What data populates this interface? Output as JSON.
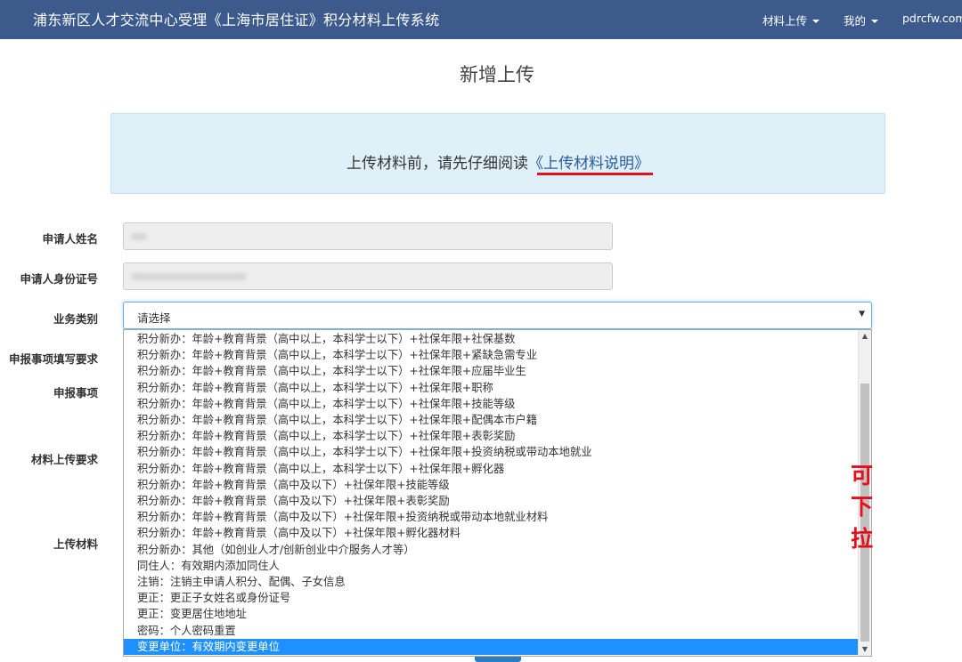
{
  "header": {
    "title": "浦东新区人才交流中心受理《上海市居住证》积分材料上传系统",
    "menu_upload": "材料上传",
    "menu_mine": "我的",
    "user": "pdrcfw.com"
  },
  "page": {
    "title": "新增上传"
  },
  "notice": {
    "prefix": "上传材料前，请先仔细阅读",
    "link": "《上传材料说明》"
  },
  "form": {
    "labels": {
      "name": "申请人姓名",
      "id_number": "申请人身份证号",
      "business_type": "业务类别",
      "fill_requirements": "申报事项填写要求",
      "declaration_item": "申报事项",
      "upload_requirements": "材料上传要求",
      "upload_material": "上传材料"
    },
    "business_type_value": "请选择"
  },
  "dropdown": {
    "options": [
      "积分新办：年龄+教育背景（高中以上，本科学士以下）+社保年限+社保基数",
      "积分新办：年龄+教育背景（高中以上，本科学士以下）+社保年限+紧缺急需专业",
      "积分新办：年龄+教育背景（高中以上，本科学士以下）+社保年限+应届毕业生",
      "积分新办：年龄+教育背景（高中以上，本科学士以下）+社保年限+职称",
      "积分新办：年龄+教育背景（高中以上，本科学士以下）+社保年限+技能等级",
      "积分新办：年龄+教育背景（高中以上，本科学士以下）+社保年限+配偶本市户籍",
      "积分新办：年龄+教育背景（高中以上，本科学士以下）+社保年限+表彰奖励",
      "积分新办：年龄+教育背景（高中以上，本科学士以下）+社保年限+投资纳税或带动本地就业",
      "积分新办：年龄+教育背景（高中以上，本科学士以下）+社保年限+孵化器",
      "积分新办：年龄+教育背景（高中及以下）+社保年限+技能等级",
      "积分新办：年龄+教育背景（高中及以下）+社保年限+表彰奖励",
      "积分新办：年龄+教育背景（高中及以下）+社保年限+投资纳税或带动本地就业材料",
      "积分新办：年龄+教育背景（高中及以下）+社保年限+孵化器材料",
      "积分新办：其他（如创业人才/创新创业中介服务人才等）",
      "同住人：有效期内添加同住人",
      "注销：注销主申请人积分、配偶、子女信息",
      "更正：更正子女姓名或身份证号",
      "更正：变更居住地地址",
      "密码：个人密码重置",
      "变更单位：有效期内变更单位"
    ],
    "selected_index": 19
  },
  "annotation": {
    "chars": [
      "可",
      "下",
      "拉"
    ],
    "color": "#e3101c"
  },
  "colors": {
    "navbar": "#3c5a8c",
    "notice_bg": "#dff0f8",
    "selected_option": "#1e90ff"
  }
}
